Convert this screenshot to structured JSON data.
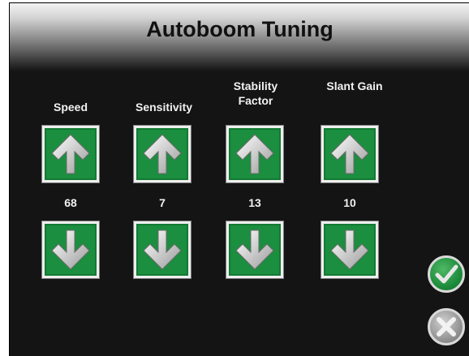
{
  "title": "Autoboom Tuning",
  "columns": [
    {
      "label": "Speed",
      "value": "68"
    },
    {
      "label": "Sensitivity",
      "value": "7"
    },
    {
      "label": "Stability Factor",
      "value": "13"
    },
    {
      "label": "Slant Gain",
      "value": "10"
    }
  ],
  "icons": {
    "up": "arrow-up-icon",
    "down": "arrow-down-icon",
    "accept": "checkmark-icon",
    "cancel": "close-icon"
  },
  "colors": {
    "button_green": "#1b8e3f",
    "background": "#141414"
  }
}
